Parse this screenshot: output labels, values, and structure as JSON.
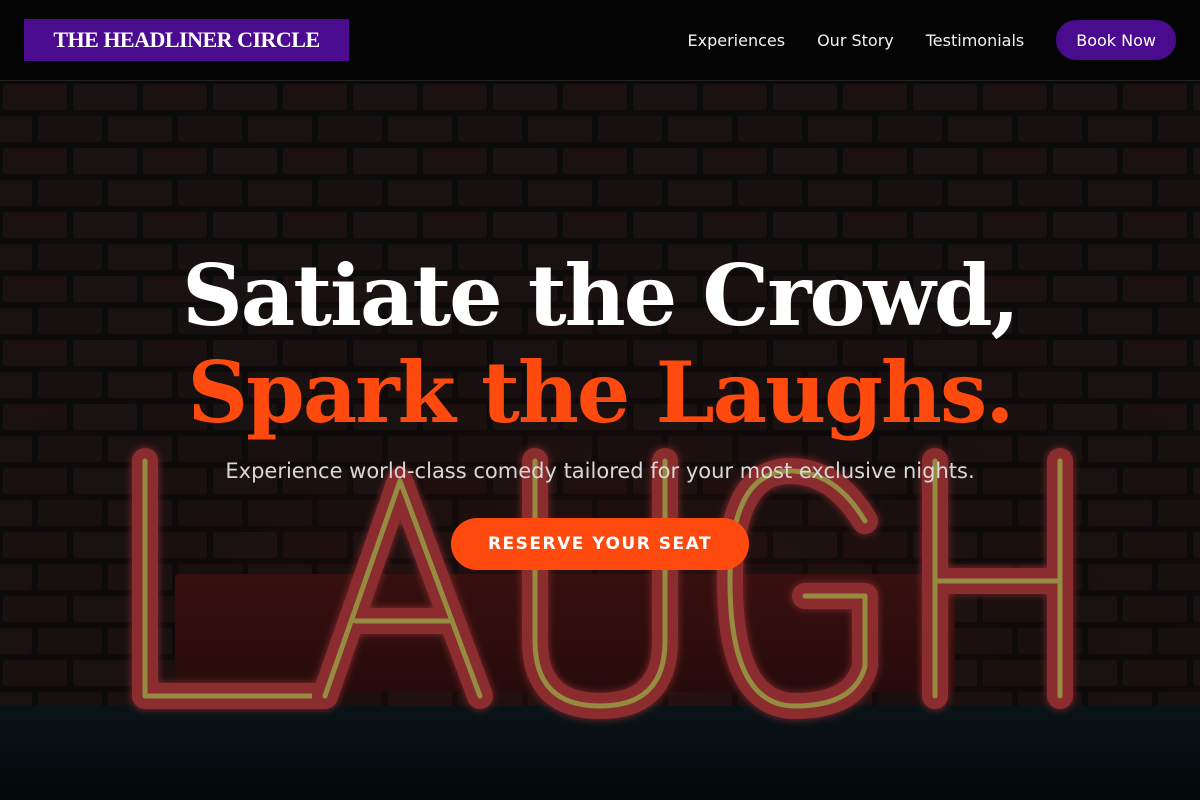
{
  "brand": {
    "name": "THE HEADLINER CIRCLE",
    "color": "#4a0b8e"
  },
  "nav": {
    "links": [
      {
        "label": "Experiences"
      },
      {
        "label": "Our Story"
      },
      {
        "label": "Testimonials"
      }
    ],
    "book_label": "Book Now"
  },
  "hero": {
    "title_line1": "Satiate the Crowd,",
    "title_line2": "Spark the Laughs.",
    "subtitle": "Experience world-class comedy tailored for your most exclusive nights.",
    "cta_label": "RESERVE YOUR SEAT",
    "sign_text": "LAUGH",
    "accent_color": "#ff4a0f"
  }
}
